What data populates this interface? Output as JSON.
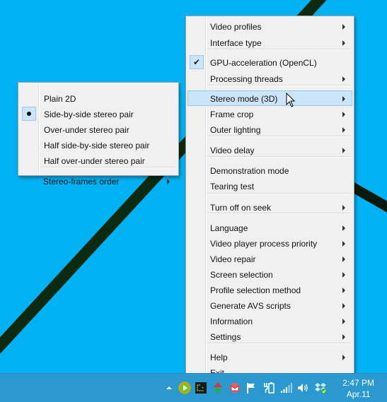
{
  "main_menu": {
    "items": [
      {
        "label": "Video profiles",
        "submenu": true
      },
      {
        "label": "Interface type",
        "submenu": true
      },
      {
        "label": "GPU-acceleration (OpenCL)",
        "checked": true
      },
      {
        "label": "Processing threads",
        "submenu": true
      },
      {
        "label": "Stereo mode (3D)",
        "submenu": true,
        "highlighted": true
      },
      {
        "label": "Frame crop",
        "submenu": true
      },
      {
        "label": "Outer lighting",
        "submenu": true
      },
      {
        "label": "Video delay",
        "submenu": true
      },
      {
        "label": "Demonstration mode"
      },
      {
        "label": "Tearing test"
      },
      {
        "label": "Turn off on seek",
        "submenu": true
      },
      {
        "label": "Language",
        "submenu": true
      },
      {
        "label": "Video player process priority",
        "submenu": true
      },
      {
        "label": "Video repair",
        "submenu": true
      },
      {
        "label": "Screen selection",
        "submenu": true
      },
      {
        "label": "Profile selection method",
        "submenu": true
      },
      {
        "label": "Generate AVS scripts",
        "submenu": true
      },
      {
        "label": "Information",
        "submenu": true
      },
      {
        "label": "Settings",
        "submenu": true
      },
      {
        "label": "Help",
        "submenu": true
      },
      {
        "label": "Exit"
      }
    ],
    "check_glyph": "✔"
  },
  "stereo_submenu": {
    "items": [
      {
        "label": "Plain 2D"
      },
      {
        "label": "Side-by-side stereo pair",
        "selected": true
      },
      {
        "label": "Over-under stereo pair"
      },
      {
        "label": "Half side-by-side stereo pair"
      },
      {
        "label": "Half over-under stereo pair"
      },
      {
        "label": "Stereo-frames order",
        "submenu": true
      }
    ]
  },
  "taskbar": {
    "tray_icons": [
      "show-hidden-icons-arrow",
      "media-player-icon",
      "terminal-monitor-icon",
      "up-down-arrows-icon",
      "mail-notifier-icon",
      "action-center-flag-icon",
      "battery-power-icon",
      "network-signal-icon",
      "volume-icon",
      "dropbox-synced-icon"
    ],
    "clock_time": "2:47 PM",
    "clock_date": "Apr.11"
  },
  "colors": {
    "desktop": "#00b2f4",
    "taskbar": "#2b99cf",
    "menu_bg": "#f0f0f0",
    "highlight": "#cce4f7",
    "highlight_border": "#99c9ef"
  }
}
